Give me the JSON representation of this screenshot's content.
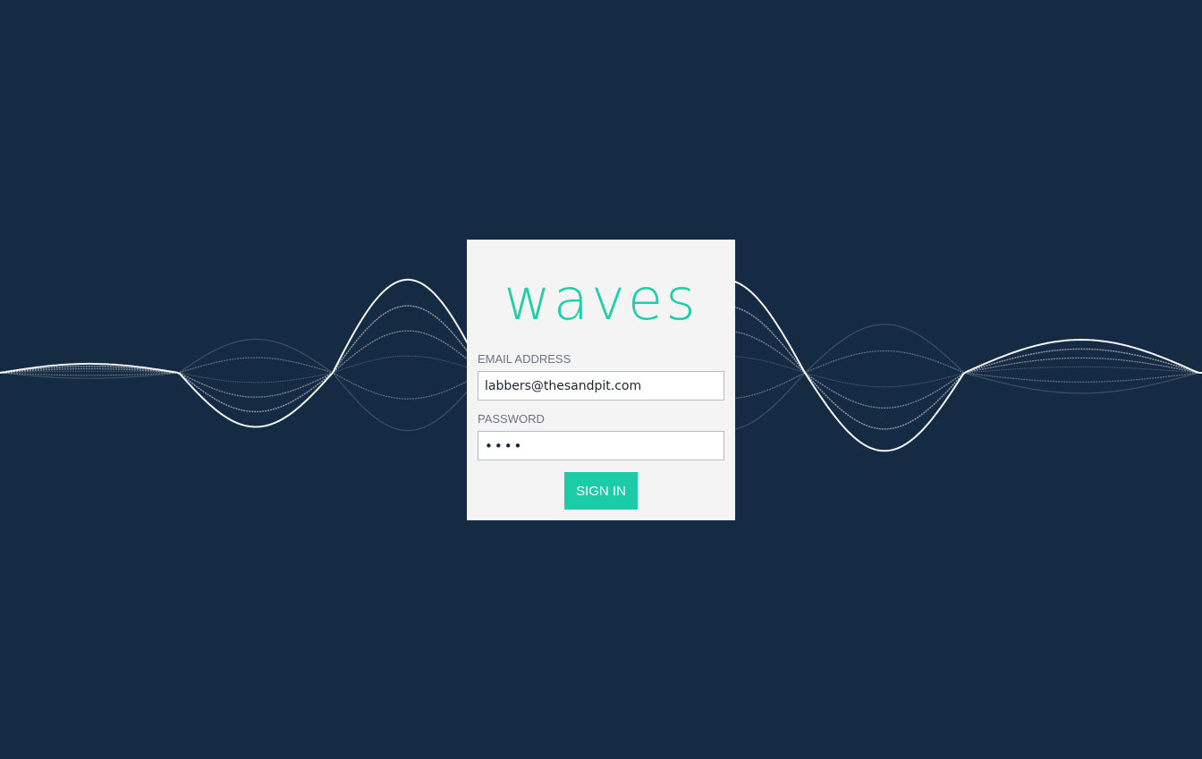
{
  "app": {
    "logo_text": "waves"
  },
  "form": {
    "email": {
      "label": "EMAIL ADDRESS",
      "value": "labbers@thesandpit.com"
    },
    "password": {
      "label": "PASSWORD",
      "value": "••••"
    },
    "submit_label": "SIGN IN"
  },
  "colors": {
    "background": "#152a43",
    "card": "#f4f4f4",
    "accent": "#1ccca8",
    "wave": "#ffffff"
  }
}
